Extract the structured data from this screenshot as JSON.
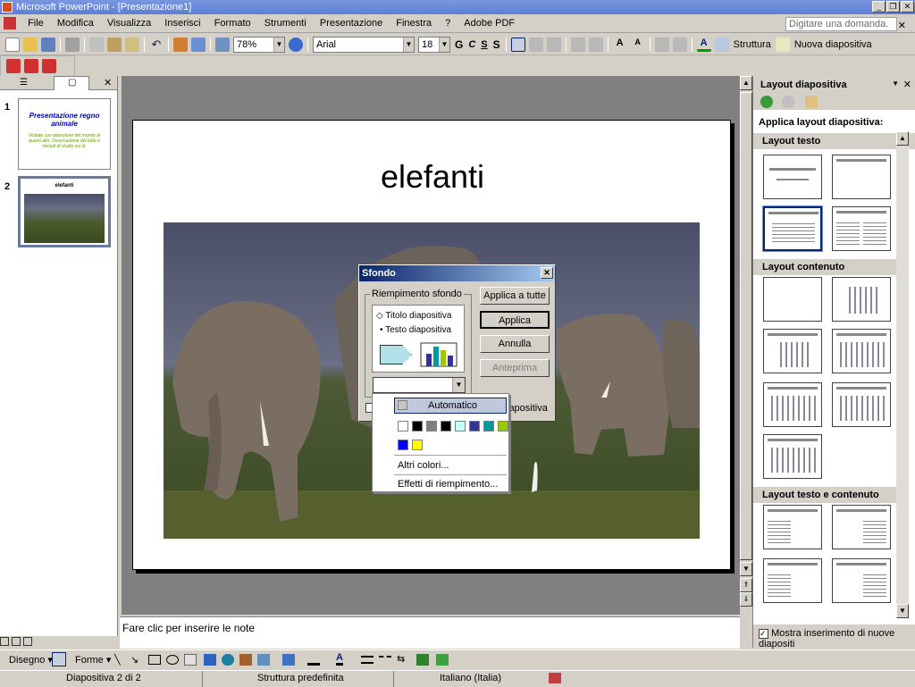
{
  "window": {
    "title": "Microsoft PowerPoint - [Presentazione1]"
  },
  "menu": [
    "File",
    "Modifica",
    "Visualizza",
    "Inserisci",
    "Formato",
    "Strumenti",
    "Presentazione",
    "Finestra",
    "?",
    "Adobe PDF"
  ],
  "help": {
    "placeholder": "Digitare una domanda."
  },
  "toolbar": {
    "zoom": "78%",
    "font": "Arial",
    "size": "18",
    "bold": "G",
    "italic": "C",
    "underline": "S",
    "shadow": "S",
    "outline": "Struttura",
    "new_slide": "Nuova diapositiva"
  },
  "slides": [
    {
      "num": "1",
      "title": "Presentazione regno animale",
      "body": "Visitate con attenzione del mondo di quanti altri. Osservazione del tutto e metodi di studio sui di."
    },
    {
      "num": "2",
      "title": "elefanti"
    }
  ],
  "slide": {
    "title": "elefanti"
  },
  "notes": {
    "placeholder": "Fare clic per inserire le note"
  },
  "taskpane": {
    "title": "Layout diapositiva",
    "apply": "Applica layout diapositiva:",
    "sections": [
      "Layout testo",
      "Layout contenuto",
      "Layout testo e contenuto"
    ],
    "show_checkbox": "Mostra inserimento di nuove diapositi"
  },
  "dialog": {
    "title": "Sfondo",
    "group": "Riempimento sfondo",
    "preview_title": "Titolo diapositiva",
    "preview_text": "Testo diapositiva",
    "buttons": [
      "Applica a tutte",
      "Applica",
      "Annulla",
      "Anteprima"
    ],
    "behind_label": "iapositiva"
  },
  "popup": {
    "automatic": "Automatico",
    "more": "Altri colori...",
    "effects": "Effetti di riempimento...",
    "swatches_row1": [
      "#ffffff",
      "#000000",
      "#808080",
      "#000000",
      "#c0ffff",
      "#333399",
      "#009999",
      "#99cc00"
    ],
    "swatches_row2": [
      "#0000ff",
      "#ffff00"
    ]
  },
  "drawing": {
    "draw": "Disegno",
    "shapes": "Forme"
  },
  "status": {
    "slide": "Diapositiva 2 di 2",
    "design": "Struttura predefinita",
    "lang": "Italiano (Italia)"
  },
  "colors": {
    "title_blue": "#0a246a",
    "slide1_title": "#0000cc",
    "slide1_text": "#669900"
  }
}
